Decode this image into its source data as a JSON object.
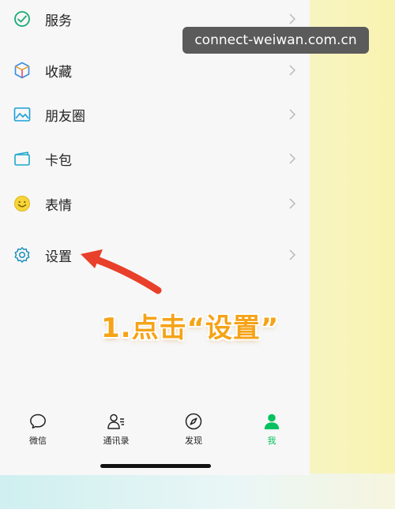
{
  "menu": {
    "items": [
      {
        "label": "服务",
        "icon": "service-icon"
      },
      {
        "label": "收藏",
        "icon": "favorites-cube-icon"
      },
      {
        "label": "朋友圈",
        "icon": "moments-image-icon"
      },
      {
        "label": "卡包",
        "icon": "card-wallet-icon"
      },
      {
        "label": "表情",
        "icon": "sticker-smile-icon"
      },
      {
        "label": "设置",
        "icon": "settings-gear-icon"
      }
    ]
  },
  "watermark": {
    "text": "connect-weiwan.com.cn"
  },
  "annotation": {
    "text": "1.点击“设置”"
  },
  "tabbar": {
    "tabs": [
      {
        "label": "微信",
        "icon": "chat-bubble-icon"
      },
      {
        "label": "通讯录",
        "icon": "contacts-icon"
      },
      {
        "label": "发现",
        "icon": "compass-icon"
      },
      {
        "label": "我",
        "icon": "me-person-icon",
        "active": true
      }
    ]
  },
  "colors": {
    "accent": "#07c160",
    "annotation": "#f5a317",
    "arrow": "#e8402a",
    "icon_teal": "#1aa8a8"
  }
}
